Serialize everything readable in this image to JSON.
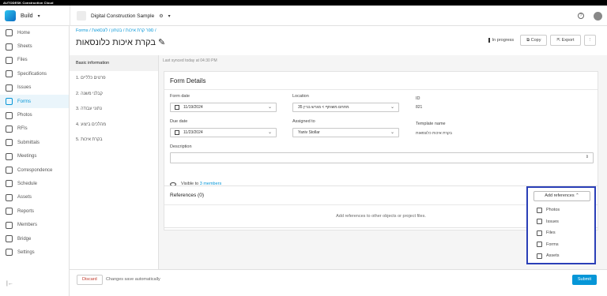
{
  "brand": "AUTODESK Construction Cloud",
  "header": {
    "product": "Build",
    "project": "Digital Construction Sample",
    "help": "?"
  },
  "sidebar": {
    "items": [
      {
        "label": "Home",
        "icon": "home-icon"
      },
      {
        "label": "Sheets",
        "icon": "sheets-icon"
      },
      {
        "label": "Files",
        "icon": "files-icon"
      },
      {
        "label": "Specifications",
        "icon": "specifications-icon"
      },
      {
        "label": "Issues",
        "icon": "issues-icon"
      },
      {
        "label": "Forms",
        "icon": "forms-icon",
        "active": true
      },
      {
        "label": "Photos",
        "icon": "photos-icon"
      },
      {
        "label": "RFIs",
        "icon": "rfis-icon"
      },
      {
        "label": "Submittals",
        "icon": "submittals-icon"
      },
      {
        "label": "Meetings",
        "icon": "meetings-icon"
      },
      {
        "label": "Correspondence",
        "icon": "correspondence-icon"
      },
      {
        "label": "Schedule",
        "icon": "schedule-icon"
      },
      {
        "label": "Assets",
        "icon": "assets-icon"
      },
      {
        "label": "Reports",
        "icon": "reports-icon"
      },
      {
        "label": "Members",
        "icon": "members-icon"
      },
      {
        "label": "Bridge",
        "icon": "bridge-icon"
      },
      {
        "label": "Settings",
        "icon": "settings-icon"
      }
    ],
    "collapse": "|←"
  },
  "breadcrumb": "Forms / ספר קרת איכות / בטחון / לונסואות /",
  "title": "בקרת איכות כלונסאות",
  "actions": {
    "status": "In progress",
    "copy": "Copy",
    "export": "Export",
    "more": "⋮"
  },
  "sections": [
    {
      "label": "Basic information",
      "active": true
    },
    {
      "label": "1. פרטים כלליים"
    },
    {
      "label": "2. קבלני משנה"
    },
    {
      "label": "3. נתוני עבודה"
    },
    {
      "label": "4. מהלכים ביצוע"
    },
    {
      "label": "5. בקרת איכות"
    }
  ],
  "synced": "Last synced today at 04:30 PM",
  "form": {
    "title": "Form Details",
    "form_date_label": "Form date",
    "form_date": "11/19/2024",
    "location_label": "Location",
    "location": "35 מתחם משותף > מגרש בניין",
    "id_label": "ID",
    "id": "821",
    "due_date_label": "Due date",
    "due_date": "11/23/2024",
    "assigned_label": "Assigned to",
    "assigned": "Yaniv Stollar",
    "template_label": "Template name",
    "template": "בקרת איכות כלונסאות",
    "description_label": "Description",
    "visible_prefix": "Visible to",
    "visible_link": "3 members"
  },
  "references": {
    "title": "References (0)",
    "empty": "Add references to other objects or project files.",
    "button": "Add references",
    "options": [
      {
        "label": "Photos",
        "icon": "photos-icon"
      },
      {
        "label": "Issues",
        "icon": "issues-icon"
      },
      {
        "label": "Files",
        "icon": "files-icon"
      },
      {
        "label": "Forms",
        "icon": "forms-icon"
      },
      {
        "label": "Assets",
        "icon": "assets-icon"
      }
    ]
  },
  "footer": {
    "discard": "Discard",
    "autosave": "Changes save automatically",
    "submit": "Submit"
  }
}
